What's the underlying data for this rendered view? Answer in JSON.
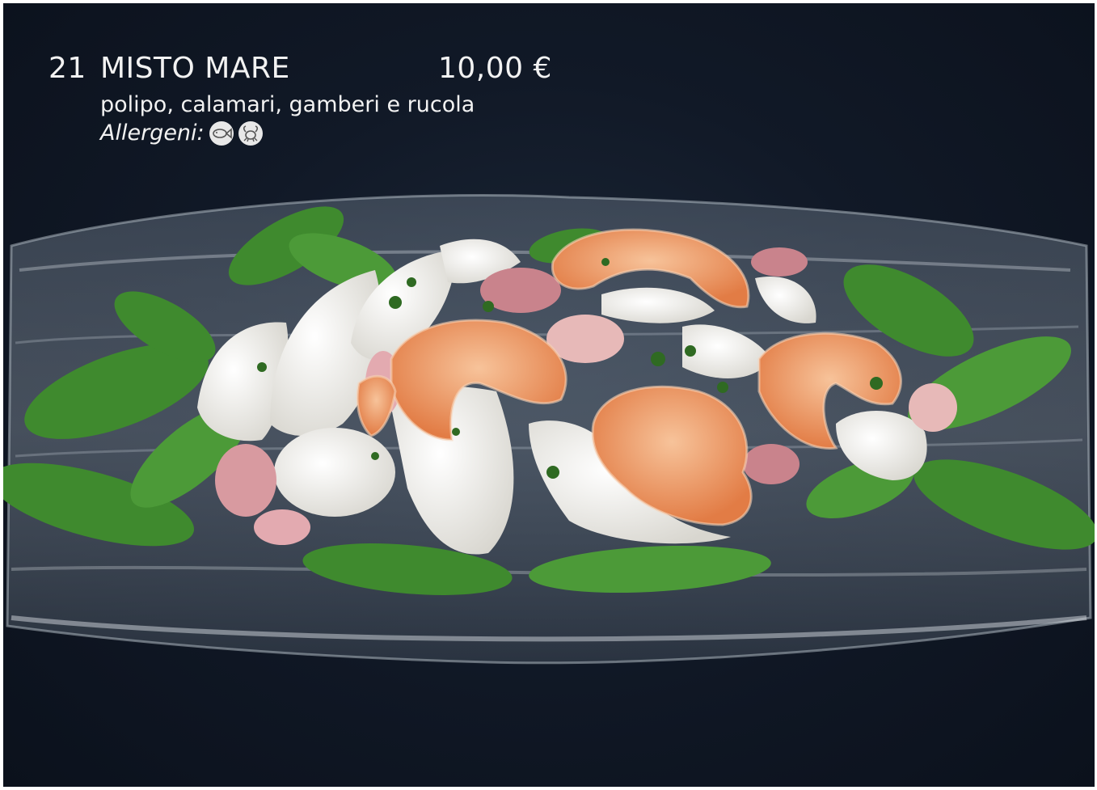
{
  "menu_item": {
    "number": "21",
    "name": "MISTO MARE",
    "price": "10,00 €",
    "description": "polipo, calamari, gamberi e rucola",
    "allergens_label": "Allergeni:",
    "allergen_icons": [
      "fish-icon",
      "crustacean-icon"
    ]
  },
  "colors": {
    "background": "#111927",
    "text": "#f2f2f2",
    "arugula": "#3f8a2e",
    "shrimp": "#f0a070",
    "squid": "#ecebe4",
    "octopus": "#d89aa0"
  }
}
